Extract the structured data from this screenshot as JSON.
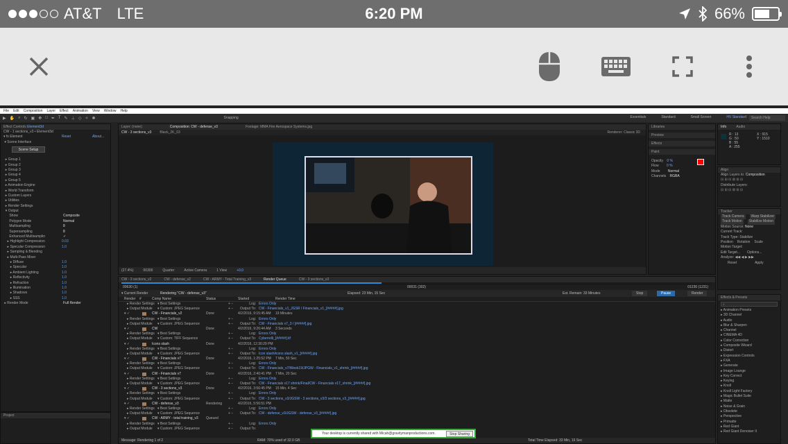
{
  "status": {
    "carrier": "AT&T",
    "network": "LTE",
    "time": "6:20 PM",
    "battery": "66%",
    "battery_level": 0.66
  },
  "toolbar": {
    "close": "close-icon",
    "mouse": "mouse-icon",
    "keyboard": "keyboard-icon",
    "fullscreen": "fullscreen-icon",
    "more": "more-vert-icon"
  },
  "ae": {
    "menu": [
      "File",
      "Edit",
      "Composition",
      "Layer",
      "Effect",
      "Animation",
      "View",
      "Window",
      "Help"
    ],
    "snapping": "Snapping",
    "workspaces": [
      "Essentials",
      "Standard",
      "Small Screen",
      "HV Standard"
    ],
    "search": "Search Help",
    "effect_controls": {
      "tab": "Effect Controls",
      "tab_item": "Element3d",
      "path": "CW - 1 sections_v3 • Element3d",
      "fx": "Element",
      "reset": "Reset",
      "about": "About...",
      "scene_interface": "Scene Interface",
      "scene_setup": "Scene Setup",
      "groups": [
        "Group 1",
        "Group 2",
        "Group 3",
        "Group 4",
        "Group 5",
        "Animation Engine",
        "World Transform",
        "Custom Layers",
        "Utilities",
        "Render Settings",
        "Output"
      ],
      "output": [
        [
          "Show",
          "Composite"
        ],
        [
          "Polygon Mode",
          "Normal"
        ],
        [
          "Multisampling",
          "8"
        ],
        [
          "Supersampling",
          "8"
        ],
        [
          "Enhanced Multisamplin",
          "✓"
        ],
        [
          "Highlight Compression",
          "0.03"
        ],
        [
          "Specular Compression",
          "1.0"
        ],
        [
          "Sampling & Blending",
          ""
        ],
        [
          "Multi-Pass Mixer",
          ""
        ]
      ],
      "mixer": [
        [
          "Diffuse",
          "1.0"
        ],
        [
          "Specular",
          "1.0"
        ],
        [
          "Ambient Lighting",
          "1.0"
        ],
        [
          "Reflectivity",
          "1.0"
        ],
        [
          "Refraction",
          "1.0"
        ],
        [
          "Illumination",
          "1.0"
        ],
        [
          "Shadows",
          "1.0"
        ],
        [
          "SSS",
          "1.0"
        ]
      ],
      "render_mode": [
        "Render Mode",
        "Full Render"
      ],
      "project": "Project"
    },
    "viewer": {
      "tabs": [
        "Layer: (none)",
        "Composition: CW - defense_v3",
        "Footage: MMA Fire Aerospace Systems.jpg"
      ],
      "subtabs": [
        "CW - 3 sections_v3",
        "Black_2K_03"
      ],
      "renderer": "Renderer:",
      "renderer_val": "Classic 3D",
      "zoom": "(27.4%)",
      "timecode": "00300",
      "quality": "Quarter",
      "camera": "Active Camera",
      "views": "1 View",
      "offset": "+0.0"
    },
    "right": {
      "tabs": [
        "Libraries",
        "Preview",
        "Effects",
        "Paint"
      ],
      "info": "Info",
      "audio": "Audio",
      "rgb": [
        "R : 13",
        "G : 50",
        "B : 55",
        "A : 255"
      ],
      "xy": [
        "X : 915",
        "Y : 1510"
      ],
      "opacity": "Opacity",
      "flow": "Flow",
      "mode": "Mode",
      "mode_val": "Normal",
      "channels": "Channels",
      "channels_val": "RGBA",
      "opacity_val": "0 %",
      "flow_val": "0 %",
      "align": "Align",
      "align_to": "Align Layers to:",
      "align_val": "Composition",
      "distribute": "Distribute Layers:",
      "tracker": "Tracker",
      "track_camera": "Track Camera",
      "warp": "Warp Stabilizer",
      "track_motion": "Track Motion",
      "stabilize": "Stabilize Motion",
      "motion_source": "Motion Source:",
      "motion_val": "None",
      "current_track": "Current Track:",
      "track_type": "Track Type:",
      "track_type_val": "Stabilize",
      "position": "Position",
      "rotation": "Rotation",
      "scale": "Scale",
      "motion_target": "Motion Target:",
      "edit_target": "Edit Target...",
      "options": "Options...",
      "analyze": "Analyze:",
      "reset": "Reset",
      "apply": "Apply",
      "effects_presets": "Effects & Presets",
      "effects": [
        "Animation Presets",
        "3D Channel",
        "Audio",
        "Blur & Sharpen",
        "Channel",
        "CINEMA 4D",
        "Color Correction",
        "Composite Wizard",
        "Distort",
        "Expression Controls",
        "FXA",
        "Generate",
        "Image Lounge",
        "Key Correct",
        "Keying",
        "Knoll",
        "Knoll Light Factory",
        "Magic Bullet Suite",
        "Matte",
        "Noise & Grain",
        "Obsolete",
        "Perspective",
        "Primatte",
        "Red Giant",
        "Red Giant Denoiser II"
      ]
    },
    "bottom": {
      "tabs": [
        "CW - 3 sections_v2",
        "CW - defense_v2",
        "CW - ARMY - Total Training_v3",
        "Render Queue",
        "CW - 3 sections_v3"
      ],
      "current_time": "00630 (1)",
      "mid": "00031 (302)",
      "end": "01230 (1231)",
      "current_render": "Current Render",
      "rendering": "Rendering \"CW - defense_v3\"",
      "elapsed": "Elapsed: 23 Min, 15 Sec",
      "est": "Est. Remain: 33 Minutes",
      "stop": "Stop",
      "pause": "Pause",
      "render": "Render",
      "cols": [
        "Render",
        "#",
        "Comp Name",
        "Status",
        "Started",
        "Render Time"
      ],
      "rows": [
        [
          "Render Settings",
          "Best Settings",
          "",
          "Log:",
          "Errors Only"
        ],
        [
          "Output Module",
          "Custom: JPEG Sequence",
          "",
          "Output To:",
          "CW - Financials_v1_JGSR / Financials_v1_[#####].jpg"
        ],
        [
          "CW - Financials_v2",
          "",
          "Done",
          "4/2/2016, 9:15:45 AM",
          "19 Minutes"
        ],
        [
          "Render Settings",
          "Best Settings",
          "",
          "Log:",
          "Errors Only"
        ],
        [
          "Output Module",
          "Custom: JPEG Sequence",
          "",
          "Output To:",
          "CW - Financials v7_3 / [#####].jpg"
        ],
        [
          "CW",
          "",
          "Done",
          "4/2/2016, 9:26:44 AM",
          "3 Seconds"
        ],
        [
          "Render Settings",
          "Best Settings",
          "",
          "Log:",
          "Errors Only"
        ],
        [
          "Output Module",
          "Custom: TIFF Sequence",
          "",
          "Output To:",
          "Cyberrelli_[#####].tif"
        ],
        [
          "Icons slash",
          "",
          "Done",
          "4/2/2016, 12:30:29 PM",
          ""
        ],
        [
          "Render Settings",
          "Best Settings",
          "",
          "Log:",
          "Errors Only"
        ],
        [
          "Output Module",
          "Custom: JPEG Sequence",
          "",
          "Output To:",
          "Icon slash/icons slash_v1_[#####].jpg"
        ],
        [
          "CW - Financials v7",
          "",
          "Done",
          "4/2/2016, 1:25:52 PM",
          "7 Min, 50 Sec"
        ],
        [
          "Render Settings",
          "Best Settings",
          "",
          "Log:",
          "Errors Only"
        ],
        [
          "Output Module",
          "Custom: JPEG Sequence",
          "",
          "Output To:",
          "CW - Financials_v7/Week19/JPGW - Financials_v1_shrink_[#####].jpg"
        ],
        [
          "CW - Financials v7",
          "",
          "Done",
          "4/2/2016, 2:40:41 PM",
          "7 Min, 20 Sec"
        ],
        [
          "Render Settings",
          "Best Settings",
          "",
          "Log:",
          "Errors Only"
        ],
        [
          "Output Module",
          "Custom: JPEG Sequence",
          "",
          "Output To:",
          "CW - Financials v17 shrink/Final/CW - Financials v17_shrink_[#####].jpg"
        ],
        [
          "CW - 3 sections_v3",
          "",
          "Done",
          "4/2/2016, 3:56:45 PM",
          "15 Min, 4 Sec"
        ],
        [
          "Render Settings",
          "Best Settings",
          "",
          "Log:",
          "Errors Only"
        ],
        [
          "Output Module",
          "Custom: JPEG Sequence",
          "",
          "Output To:",
          "CW - 3 sections_v3/JGSW - 3 sections_v3/3 sections_v3_[#####].jpg"
        ],
        [
          "CW - defense_v3",
          "",
          "Rendering",
          "4/2/2016, 5:56:51 PM",
          ""
        ],
        [
          "Render Settings",
          "Best Settings",
          "",
          "Log:",
          "Errors Only"
        ],
        [
          "Output Module",
          "Custom: JPEG Sequence",
          "",
          "Output To:",
          "CW - defense_v3/JGSW - defense_v3_[#####].jpg"
        ],
        [
          "CW - ARMY - total training_v3",
          "",
          "Queued",
          "",
          ""
        ],
        [
          "Render Settings",
          "Best Settings",
          "",
          "Log:",
          "Errors Only"
        ],
        [
          "Output Module",
          "Custom: JPEG Sequence",
          "",
          "Output To:",
          ""
        ]
      ],
      "message": "Message: Rendering 1 of 2",
      "ram": "RAM: 70% used of 32.0 GB",
      "total_elapsed": "Total Time Elapsed: 33 Min, 16 Sec"
    },
    "notice": {
      "text": "Your desktop is currently shared with Micah@gravitymanproductions.com.",
      "button": "Stop Sharing"
    }
  }
}
